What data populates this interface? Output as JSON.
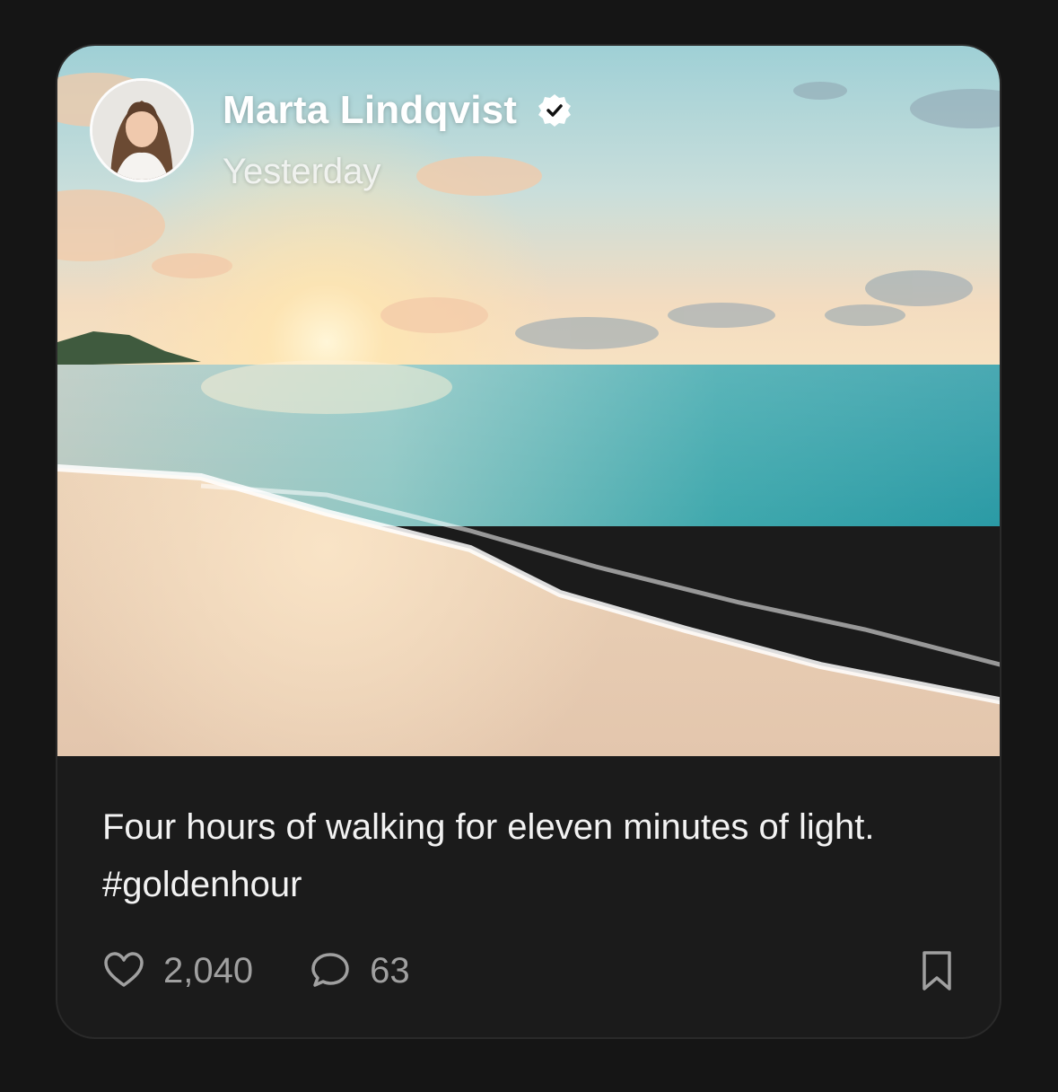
{
  "post": {
    "author": {
      "name": "Marta Lindqvist",
      "verified": true,
      "verified_icon": "verified-badge-icon",
      "timestamp": "Yesterday"
    },
    "caption_line1": "Four hours of walking for eleven minutes of light.",
    "caption_line2": "#goldenhour",
    "image": "beach sunset photo",
    "likes": "2,040",
    "comments": "63",
    "icons": {
      "like": "heart-icon",
      "comment": "comment-icon",
      "bookmark": "bookmark-icon"
    }
  },
  "colors": {
    "background": "#151515",
    "card": "#1b1b1b",
    "text": "#f2f2f2",
    "muted": "#a0a0a0"
  }
}
